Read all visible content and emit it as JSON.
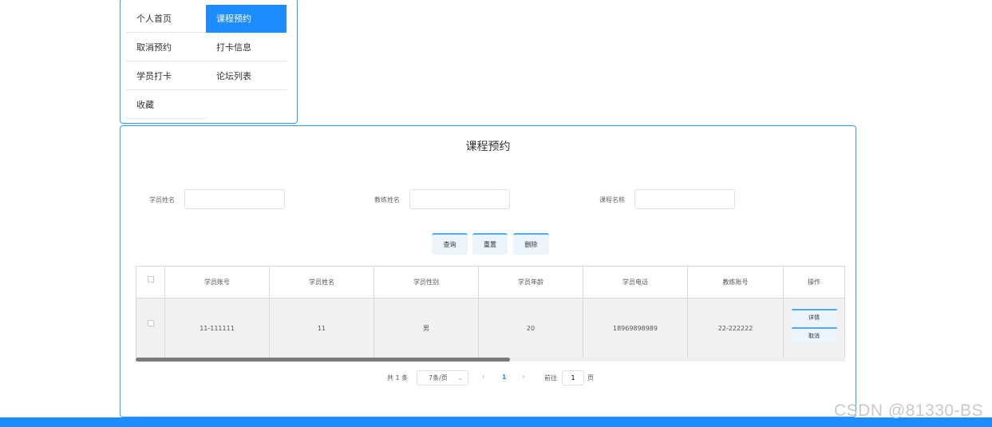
{
  "menu": {
    "items": [
      {
        "label": "个人首页"
      },
      {
        "label": "课程预约"
      },
      {
        "label": "取消预约"
      },
      {
        "label": "打卡信息"
      },
      {
        "label": "学员打卡"
      },
      {
        "label": "论坛列表"
      },
      {
        "label": "收藏"
      }
    ],
    "active_index": 1
  },
  "page": {
    "title": "课程预约"
  },
  "filters": {
    "student_name_label": "学员姓名",
    "student_name_value": "",
    "coach_name_label": "教练姓名",
    "coach_name_value": "",
    "course_name_label": "课程名称",
    "course_name_value": ""
  },
  "actions": {
    "query": "查询",
    "reset": "重置",
    "delete": "删除"
  },
  "table": {
    "headers": [
      "学员账号",
      "学员姓名",
      "学员性别",
      "学员年龄",
      "学员电话",
      "教练账号",
      "操作"
    ],
    "rows": [
      {
        "account": "11-111111",
        "name": "11",
        "gender": "男",
        "age": "20",
        "phone": "18969898989",
        "coach_account": "22-222222",
        "detail_label": "详情",
        "cancel_label": "取消"
      }
    ]
  },
  "pagination": {
    "total_text": "共 1 条",
    "page_size": "7条/页",
    "prev": "‹",
    "current_page": "1",
    "next": "›",
    "goto_label": "前往",
    "goto_value": "1",
    "page_unit": "页",
    "dropdown_arrow": "⌄"
  },
  "watermark": "CSDN @81330-BS",
  "colors": {
    "accent": "#1e8cff",
    "border": "#2b9bf3",
    "button_bg": "#ecf5fc"
  }
}
